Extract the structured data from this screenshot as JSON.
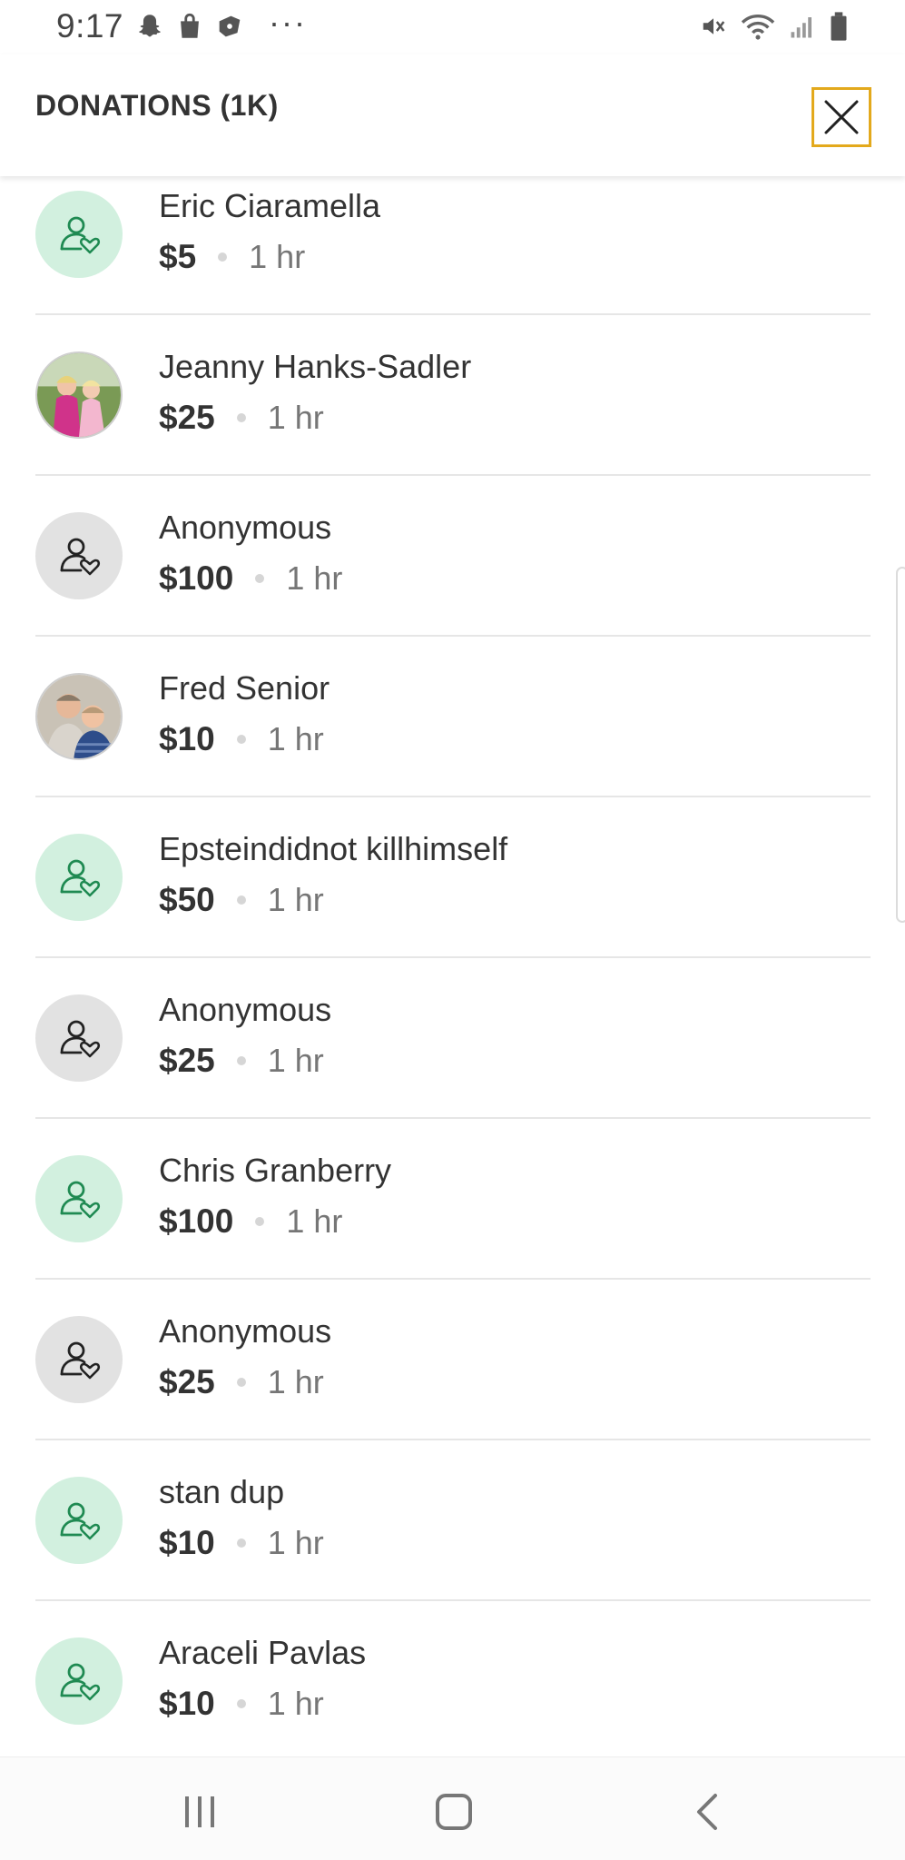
{
  "status_bar": {
    "time": "9:17",
    "dots": "···",
    "left_icons": [
      "snapchat-icon",
      "shopping-bag-icon",
      "app-icon"
    ],
    "right_icons": [
      "mute-icon",
      "wifi-icon",
      "signal-icon",
      "battery-icon"
    ]
  },
  "header": {
    "title": "DONATIONS (1K)",
    "close_icon": "close-icon",
    "close_border_color": "#e3a91c"
  },
  "donations": [
    {
      "name": "Eric Ciaramella",
      "amount": "$5",
      "time": "1 hr",
      "avatar": "green"
    },
    {
      "name": "Jeanny Hanks-Sadler",
      "amount": "$25",
      "time": "1 hr",
      "avatar": "photo-kids"
    },
    {
      "name": "Anonymous",
      "amount": "$100",
      "time": "1 hr",
      "avatar": "gray"
    },
    {
      "name": "Fred Senior",
      "amount": "$10",
      "time": "1 hr",
      "avatar": "photo-family"
    },
    {
      "name": "Epsteindidnot killhimself",
      "amount": "$50",
      "time": "1 hr",
      "avatar": "green"
    },
    {
      "name": "Anonymous",
      "amount": "$25",
      "time": "1 hr",
      "avatar": "gray"
    },
    {
      "name": "Chris Granberry",
      "amount": "$100",
      "time": "1 hr",
      "avatar": "green"
    },
    {
      "name": "Anonymous",
      "amount": "$25",
      "time": "1 hr",
      "avatar": "gray"
    },
    {
      "name": "stan dup",
      "amount": "$10",
      "time": "1 hr",
      "avatar": "green"
    },
    {
      "name": "Araceli Pavlas",
      "amount": "$10",
      "time": "1 hr",
      "avatar": "green"
    }
  ],
  "colors": {
    "avatar_green_bg": "#d2f0df",
    "avatar_green_icon": "#1f8a52",
    "avatar_gray_bg": "#e2e2e2",
    "avatar_gray_icon": "#222222"
  },
  "nav_bar": {
    "icons": [
      "recent-apps-icon",
      "home-icon",
      "back-icon"
    ]
  }
}
